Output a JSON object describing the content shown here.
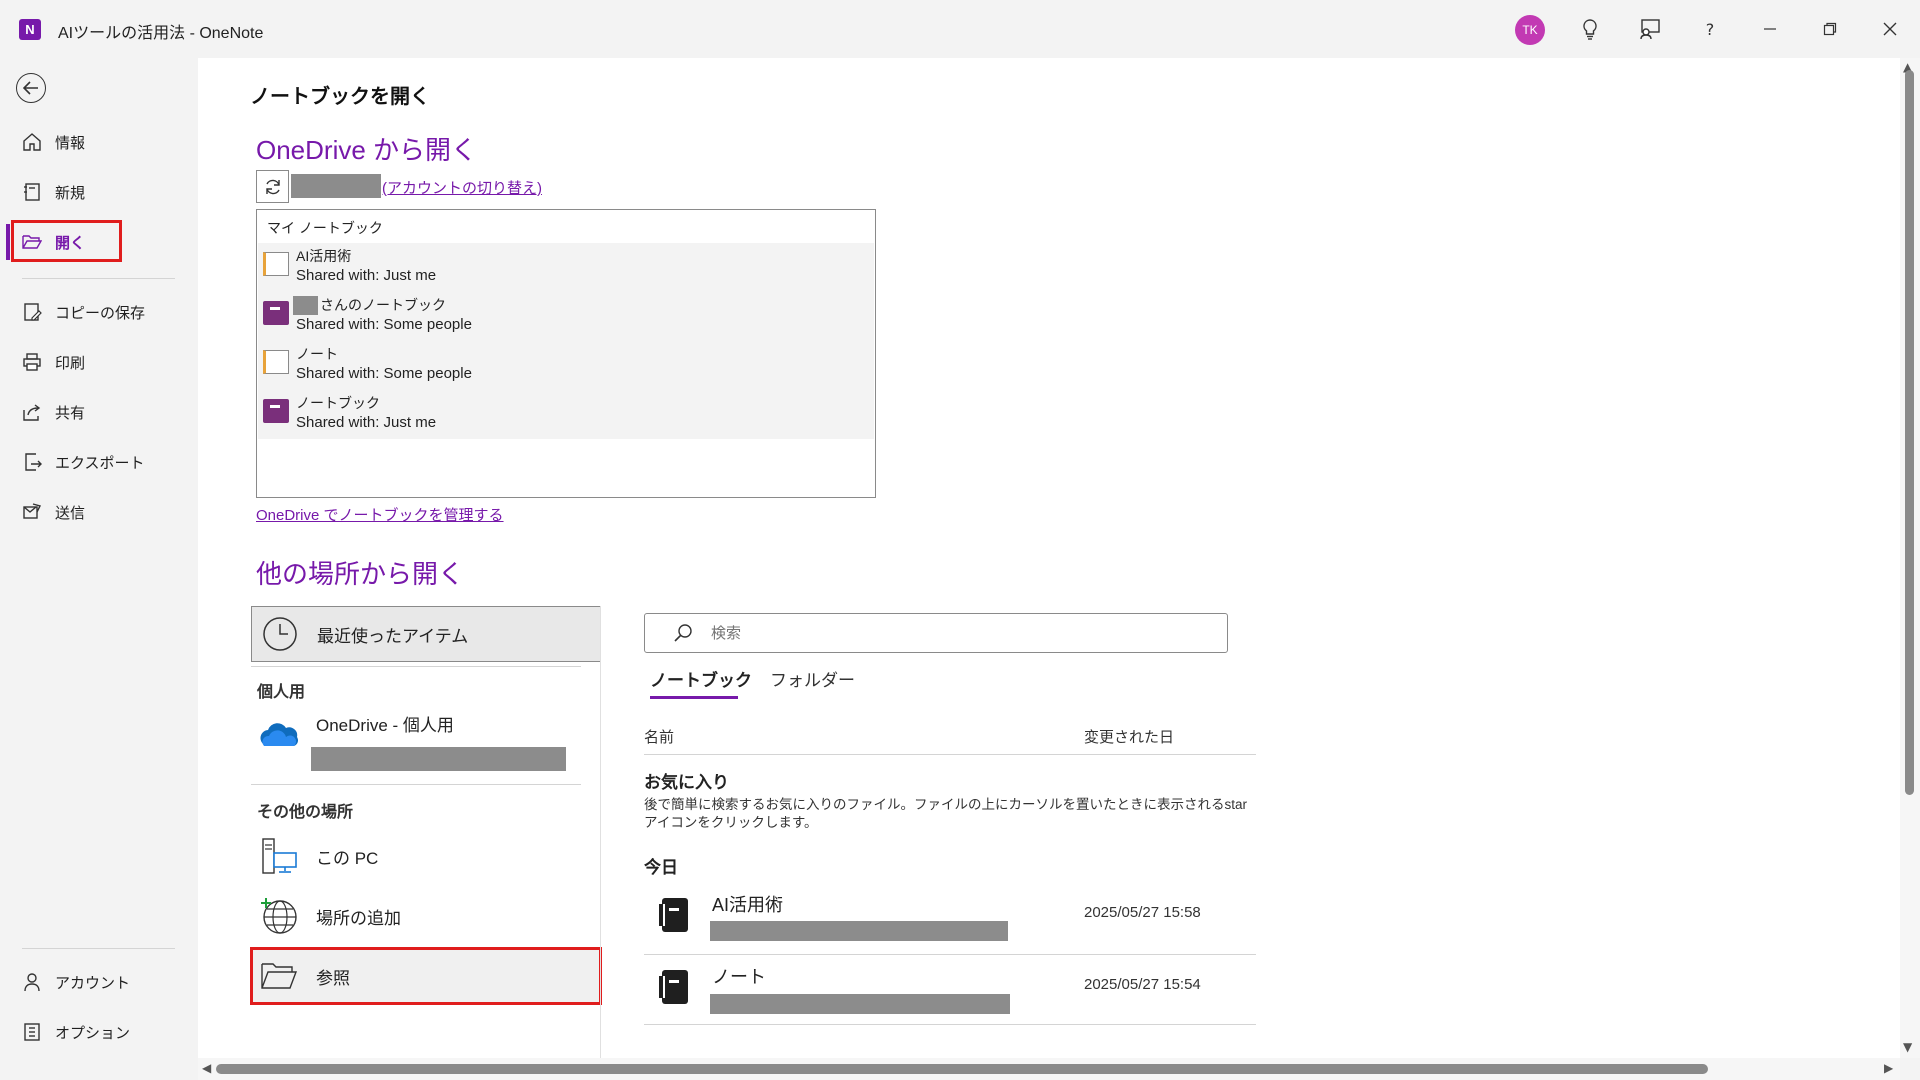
{
  "window": {
    "app_icon_letter": "N",
    "title": "AIツールの活用法  -  OneNote",
    "avatar_initials": "TK",
    "help_label": "?"
  },
  "nav": {
    "items": [
      {
        "id": "info",
        "label": "情報",
        "icon": "home-icon"
      },
      {
        "id": "new",
        "label": "新規",
        "icon": "new-notebook-icon"
      },
      {
        "id": "open",
        "label": "開く",
        "icon": "folder-open-icon",
        "active": true
      },
      {
        "id": "save-copy",
        "label": "コピーの保存",
        "icon": "save-copy-icon"
      },
      {
        "id": "print",
        "label": "印刷",
        "icon": "print-icon"
      },
      {
        "id": "share",
        "label": "共有",
        "icon": "share-icon"
      },
      {
        "id": "export",
        "label": "エクスポート",
        "icon": "export-icon"
      },
      {
        "id": "send",
        "label": "送信",
        "icon": "send-icon"
      }
    ],
    "bottom_items": [
      {
        "id": "account",
        "label": "アカウント",
        "icon": "person-icon"
      },
      {
        "id": "options",
        "label": "オプション",
        "icon": "options-icon"
      }
    ]
  },
  "main": {
    "page_title": "ノートブックを開く",
    "onedrive": {
      "title": "OneDrive から開く",
      "switch_account": "(アカウントの切り替え)",
      "list_header": "マイ ノートブック",
      "notebooks": [
        {
          "name": "AI活用術",
          "shared": "Shared with: Just me",
          "style": "outline"
        },
        {
          "name": "さんのノートブック",
          "shared": "Shared with: Some people",
          "style": "filled"
        },
        {
          "name": "ノート",
          "shared": "Shared with: Some people",
          "style": "outline"
        },
        {
          "name": "ノートブック",
          "shared": "Shared with: Just me",
          "style": "filled"
        }
      ],
      "manage_link": "OneDrive でノートブックを管理する"
    },
    "other": {
      "title": "他の場所から開く",
      "recent": "最近使ったアイテム",
      "personal_heading": "個人用",
      "onedrive_personal": "OneDrive - 個人用",
      "other_places_heading": "その他の場所",
      "this_pc": "この PC",
      "add_place": "場所の追加",
      "browse": "参照"
    },
    "search_placeholder": "検索",
    "tabs": [
      "ノートブック",
      "フォルダー"
    ],
    "columns": {
      "name": "名前",
      "modified": "変更された日"
    },
    "favorites": {
      "title": "お気に入り",
      "description": "後で簡単に検索するお気に入りのファイル。ファイルの上にカーソルを置いたときに表示されるstarアイコンをクリックします。"
    },
    "today": {
      "title": "今日",
      "files": [
        {
          "name": "AI活用術",
          "date": "2025/05/27 15:58"
        },
        {
          "name": "ノート",
          "date": "2025/05/27 15:54"
        }
      ]
    }
  },
  "colors": {
    "accent": "#7719aa",
    "highlight": "#e01d1d",
    "avatar": "#c239b3"
  }
}
